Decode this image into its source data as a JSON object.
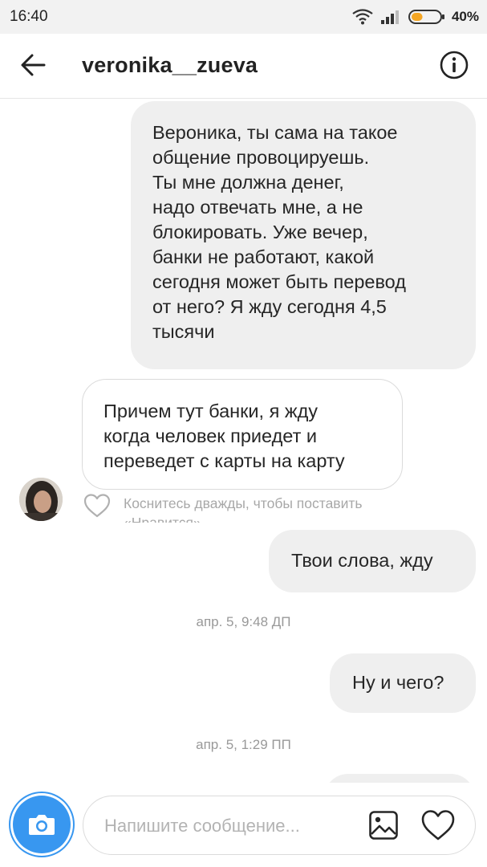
{
  "status_bar": {
    "time": "16:40",
    "battery_percent": "40%",
    "battery_level": 0.4,
    "icons": [
      "wifi-icon",
      "signal-icon",
      "battery-icon"
    ]
  },
  "header": {
    "title": "veronika__zueva",
    "back_icon": "arrow-left-icon",
    "info_icon": "info-icon"
  },
  "messages": [
    {
      "direction": "outgoing",
      "text": "Вероника, ты сама на такое\nобщение провоцируешь.\nТы мне должна денег,\nнадо отвечать мне, а не\nблокировать. Уже вечер,\nбанки не работают, какой\nсегодня может быть перевод\nот него? Я жду сегодня 4,5\nтысячи"
    },
    {
      "direction": "incoming",
      "text": "Причем тут банки, я жду\nкогда человек приедет и\nпереведет с карты на карту"
    },
    {
      "direction": "outgoing",
      "text": "Твои слова, жду"
    },
    {
      "direction": "outgoing",
      "text": "Ну и чего?"
    }
  ],
  "like_hint": "Коснитесь дважды, чтобы поставить\n«Нравится»",
  "timestamps": [
    "апр. 5, 9:48 ДП",
    "апр. 5, 1:29 ПП"
  ],
  "composer": {
    "placeholder": "Напишите сообщение...",
    "camera_icon": "camera-icon",
    "gallery_icon": "gallery-icon",
    "like_icon": "heart-icon"
  },
  "colors": {
    "accent": "#3897f0",
    "outgoing_bubble": "#efefef",
    "incoming_border": "#dbdbdb",
    "battery": "#f5a623"
  }
}
